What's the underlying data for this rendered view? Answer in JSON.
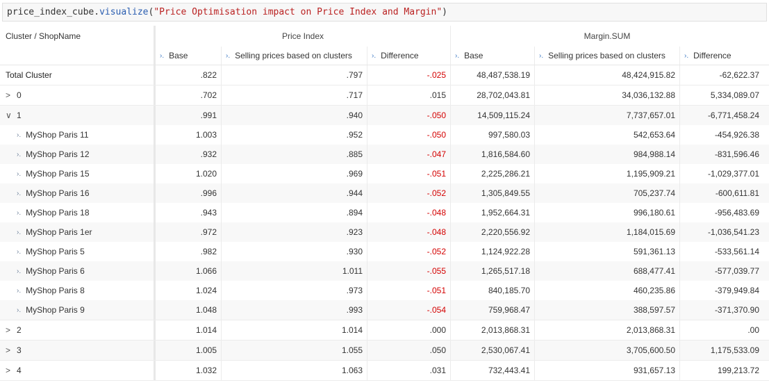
{
  "code_cell": {
    "prefix": "price_index_cube.",
    "fn": "visualize",
    "open": "(",
    "string": "\"Price Optimisation impact on Price Index and Margin\"",
    "close": ")"
  },
  "table": {
    "row_header": "Cluster / ShopName",
    "groups": [
      "Price Index",
      "Margin.SUM"
    ],
    "columns": [
      "Base",
      "Selling prices based on clusters",
      "Difference",
      "Base",
      "Selling prices based on clusters",
      "Difference"
    ],
    "rows": [
      {
        "label": "Total Cluster",
        "toggle": "",
        "v": [
          ".822",
          ".797",
          "-.025",
          "48,487,538.19",
          "48,424,915.82",
          "-62,622.37"
        ]
      },
      {
        "label": "0",
        "toggle": ">",
        "v": [
          ".702",
          ".717",
          ".015",
          "28,702,043.81",
          "34,036,132.88",
          "5,334,089.07"
        ]
      },
      {
        "label": "1",
        "toggle": "∨",
        "v": [
          ".991",
          ".940",
          "-.050",
          "14,509,115.24",
          "7,737,657.01",
          "-6,771,458.24"
        ]
      },
      {
        "label": "MyShop Paris 11",
        "v": [
          "1.003",
          ".952",
          "-.050",
          "997,580.03",
          "542,653.64",
          "-454,926.38"
        ]
      },
      {
        "label": "MyShop Paris 12",
        "v": [
          ".932",
          ".885",
          "-.047",
          "1,816,584.60",
          "984,988.14",
          "-831,596.46"
        ]
      },
      {
        "label": "MyShop Paris 15",
        "v": [
          "1.020",
          ".969",
          "-.051",
          "2,225,286.21",
          "1,195,909.21",
          "-1,029,377.01"
        ]
      },
      {
        "label": "MyShop Paris 16",
        "v": [
          ".996",
          ".944",
          "-.052",
          "1,305,849.55",
          "705,237.74",
          "-600,611.81"
        ]
      },
      {
        "label": "MyShop Paris 18",
        "v": [
          ".943",
          ".894",
          "-.048",
          "1,952,664.31",
          "996,180.61",
          "-956,483.69"
        ]
      },
      {
        "label": "MyShop Paris 1er",
        "v": [
          ".972",
          ".923",
          "-.048",
          "2,220,556.92",
          "1,184,015.69",
          "-1,036,541.23"
        ]
      },
      {
        "label": "MyShop Paris 5",
        "v": [
          ".982",
          ".930",
          "-.052",
          "1,124,922.28",
          "591,361.13",
          "-533,561.14"
        ]
      },
      {
        "label": "MyShop Paris 6",
        "v": [
          "1.066",
          "1.011",
          "-.055",
          "1,265,517.18",
          "688,477.41",
          "-577,039.77"
        ]
      },
      {
        "label": "MyShop Paris 8",
        "v": [
          "1.024",
          ".973",
          "-.051",
          "840,185.70",
          "460,235.86",
          "-379,949.84"
        ]
      },
      {
        "label": "MyShop Paris 9",
        "v": [
          "1.048",
          ".993",
          "-.054",
          "759,968.47",
          "388,597.57",
          "-371,370.90"
        ]
      },
      {
        "label": "2",
        "toggle": ">",
        "v": [
          "1.014",
          "1.014",
          ".000",
          "2,013,868.31",
          "2,013,868.31",
          ".00"
        ]
      },
      {
        "label": "3",
        "toggle": ">",
        "v": [
          "1.005",
          "1.055",
          ".050",
          "2,530,067.41",
          "3,705,600.50",
          "1,175,533.09"
        ]
      },
      {
        "label": "4",
        "toggle": ">",
        "v": [
          "1.032",
          "1.063",
          ".031",
          "732,443.41",
          "931,657.13",
          "199,213.72"
        ]
      }
    ]
  },
  "colors": {
    "negative": "#d40000",
    "accent": "#3a78c2"
  },
  "icons": {
    "column_expand": "expand-arrow-icon",
    "row_expand": "chevron-right-icon",
    "row_collapse": "chevron-down-icon"
  }
}
